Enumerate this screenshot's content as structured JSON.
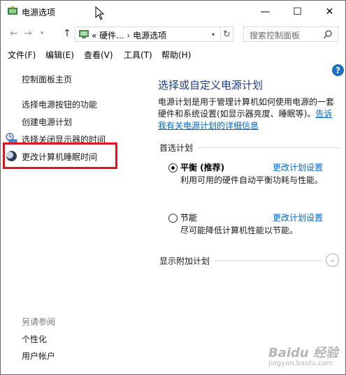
{
  "window": {
    "title": "电源选项",
    "minimize_glyph": "—",
    "maximize_glyph": "☐",
    "close_glyph": "✕"
  },
  "address_bar": {
    "back_glyph": "←",
    "forward_glyph": "→",
    "history_glyph": "▾",
    "up_glyph": "↑",
    "overflow": "«",
    "crumb1": "硬件...",
    "sep": "›",
    "crumb2": "电源选项",
    "dropdown_glyph": "▾",
    "refresh_glyph": "↻"
  },
  "search": {
    "placeholder": "搜索控制面板"
  },
  "menu": {
    "items": [
      "文件(F)",
      "编辑(E)",
      "查看(V)",
      "工具(T)",
      "帮助(H)"
    ]
  },
  "left_pane": {
    "home": "控制面板主页",
    "link1": "选择电源按钮的功能",
    "link2": "创建电源计划",
    "link3": "选择关闭显示器的时间",
    "link4": "更改计算机睡眠时间",
    "see_also_header": "另请参阅",
    "see_also_1": "个性化",
    "see_also_2": "用户帐户"
  },
  "main": {
    "help_glyph": "?",
    "title": "选择或自定义电源计划",
    "desc_text": "电源计划是用于管理计算机如何使用电源的一套硬件和系统设置(如显示器亮度、睡眠等)。",
    "desc_link": "告诉我有关电源计划的详细信息",
    "preferred_header": "首选计划",
    "plan1_name": "平衡 (推荐)",
    "plan1_link": "更改计划设置",
    "plan1_desc": "利用可用的硬件自动平衡功耗与性能。",
    "plan2_name": "节能",
    "plan2_link": "更改计划设置",
    "plan2_desc": "尽可能降低计算机性能以节能。",
    "additional_header": "显示附加计划",
    "expand_glyph": "⌄"
  },
  "watermark": {
    "brand": "Baidu 经验",
    "sub": "jingyan.baidu.com"
  },
  "colors": {
    "title_blue": "#1d3d8f",
    "link_blue": "#0066cc",
    "highlight_red": "#e0141e"
  }
}
